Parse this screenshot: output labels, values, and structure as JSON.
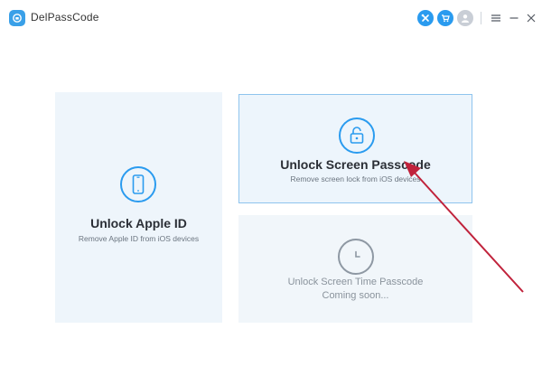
{
  "app": {
    "title": "DelPassCode"
  },
  "titlebar": {
    "icons": [
      "tools-icon",
      "cart-icon",
      "account-icon",
      "menu-icon",
      "minimize-icon",
      "close-icon"
    ]
  },
  "cards": {
    "unlock_apple_id": {
      "title": "Unlock Apple ID",
      "subtitle": "Remove Apple ID from iOS devices",
      "icon": "phone-icon"
    },
    "unlock_screen_passcode": {
      "title": "Unlock Screen Passcode",
      "subtitle": "Remove screen lock from iOS devices",
      "icon": "unlocked-lock-icon"
    },
    "unlock_screen_time": {
      "title": "Unlock Screen Time Passcode",
      "status": "Coming soon...",
      "icon": "clock-icon"
    }
  },
  "colors": {
    "accent": "#2a9bef",
    "card_bg": "#eef5fb",
    "selected_border": "#8fc4ee",
    "disabled_text": "#8a939c",
    "annotation_arrow": "#c0223b"
  }
}
